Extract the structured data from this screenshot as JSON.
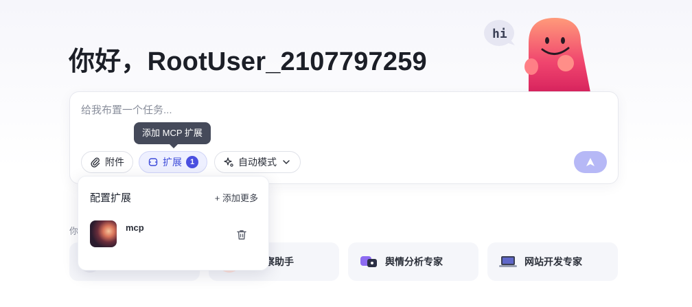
{
  "greeting": "你好，RootUser_2107797259",
  "mascot": {
    "bubble_text": "hi"
  },
  "task": {
    "placeholder": "给我布置一个任务..."
  },
  "tooltip": "添加 MCP 扩展",
  "toolbar": {
    "attach_label": "附件",
    "extension_label": "扩展",
    "extension_count": "1",
    "mode_label": "自动模式"
  },
  "suggest_label": "你",
  "agents": [
    {
      "label": "",
      "icon": "agent-icon"
    },
    {
      "label": "股观察助手",
      "icon": "stock-icon"
    },
    {
      "label": "舆情分析专家",
      "icon": "opinion-icon"
    },
    {
      "label": "网站开发专家",
      "icon": "laptop-icon"
    }
  ],
  "popup": {
    "title": "配置扩展",
    "add_more": "+ 添加更多",
    "items": [
      {
        "name": "mcp"
      }
    ]
  },
  "colors": {
    "accent": "#4a4fe0",
    "send": "#b6b8f6",
    "tooltip": "#454a5a"
  }
}
